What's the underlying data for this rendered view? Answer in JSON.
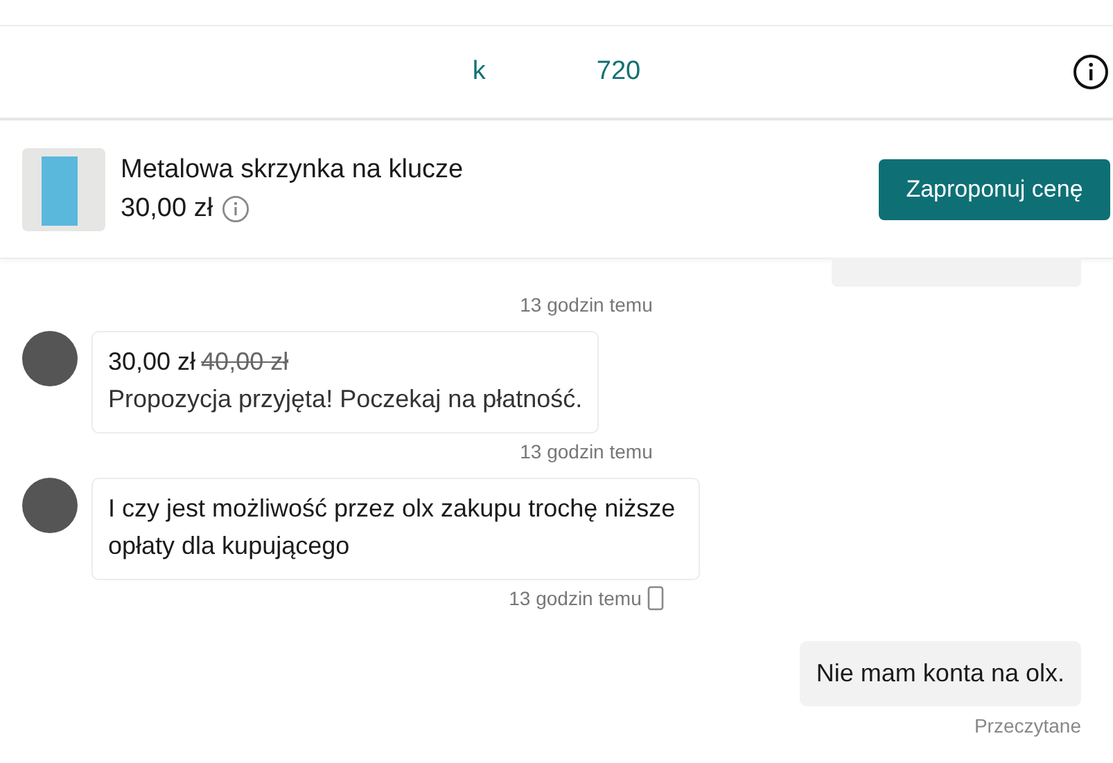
{
  "header": {
    "name_parts": [
      "k",
      "720"
    ]
  },
  "product": {
    "title": "Metalowa skrzynka na klucze",
    "price": "30,00 zł",
    "offer_button": "Zaproponuj cenę"
  },
  "messages": [
    {
      "kind": "cut"
    },
    {
      "kind": "time",
      "text": "13 godzin temu",
      "mobile": false
    },
    {
      "kind": "offer",
      "price": "30,00 zł",
      "old_price": "40,00 zł",
      "text": "Propozycja przyjęta! Poczekaj na płatność."
    },
    {
      "kind": "time",
      "text": "13 godzin temu",
      "mobile": false
    },
    {
      "kind": "received",
      "text": "I czy jest możliwość przez olx zakupu trochę niższe opłaty dla kupującego"
    },
    {
      "kind": "time",
      "text": "13 godzin temu",
      "mobile": true
    },
    {
      "kind": "sent",
      "text": "Nie mam konta na olx."
    },
    {
      "kind": "status",
      "text": "Przeczytane"
    }
  ]
}
